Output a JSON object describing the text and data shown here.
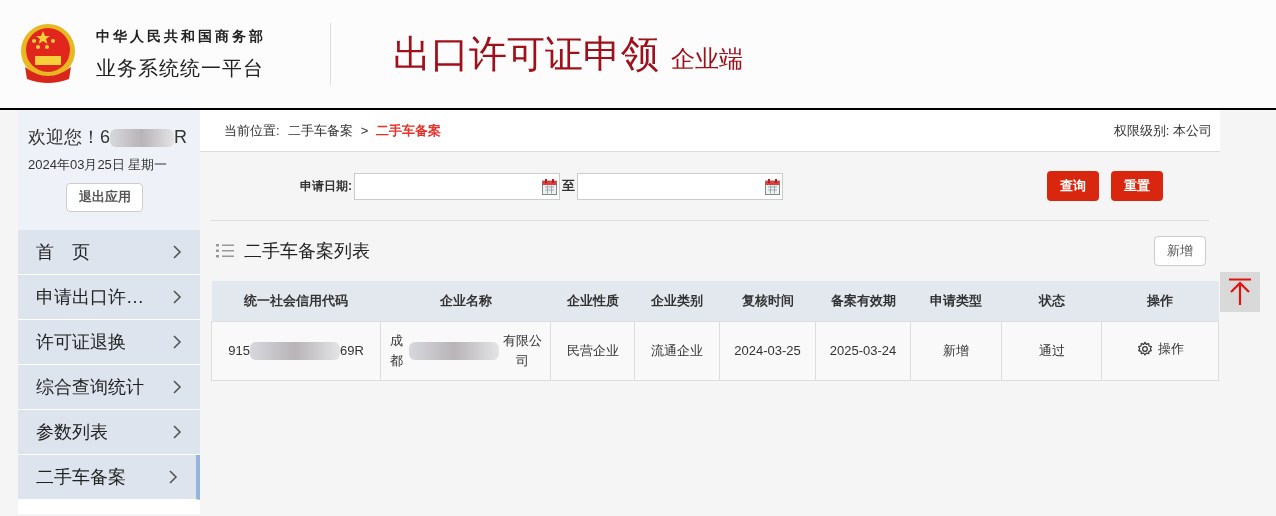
{
  "header": {
    "ministry": "中华人民共和国商务部",
    "platform": "业务系统统一平台",
    "app_title": "出口许可证申领",
    "app_subtitle": "企业端"
  },
  "sidebar": {
    "welcome_start": "欢迎您！6",
    "welcome_end": "R",
    "date": "2024年03月25日 星期一",
    "logout_button": "退出应用",
    "items": [
      {
        "label": "首　页",
        "selected": false
      },
      {
        "label": "申请出口许…",
        "selected": false
      },
      {
        "label": "许可证退换",
        "selected": false
      },
      {
        "label": "综合查询统计",
        "selected": false
      },
      {
        "label": "参数列表",
        "selected": false
      },
      {
        "label": "二手车备案",
        "selected": true
      }
    ]
  },
  "breadcrumb": {
    "label": "当前位置:",
    "parent": "二手车备案",
    "separator": ">",
    "current": "二手车备案"
  },
  "permission": "权限级别: 本公司",
  "filter": {
    "label": "申请日期:",
    "between": "至",
    "query_button": "查询",
    "reset_button": "重置"
  },
  "list": {
    "title": "二手车备案列表",
    "add_button": "新增",
    "columns": [
      "统一社会信用代码",
      "企业名称",
      "企业性质",
      "企业类别",
      "复核时间",
      "备案有效期",
      "申请类型",
      "状态",
      "操作"
    ],
    "rows": [
      {
        "code_start": "915",
        "code_end": "69R",
        "name_start": "成都",
        "name_end": "有限公司",
        "nature": "民营企业",
        "category": "流通企业",
        "review_time": "2024-03-25",
        "valid_until": "2025-03-24",
        "apply_type": "新增",
        "status": "通过",
        "action": "操作"
      }
    ]
  }
}
